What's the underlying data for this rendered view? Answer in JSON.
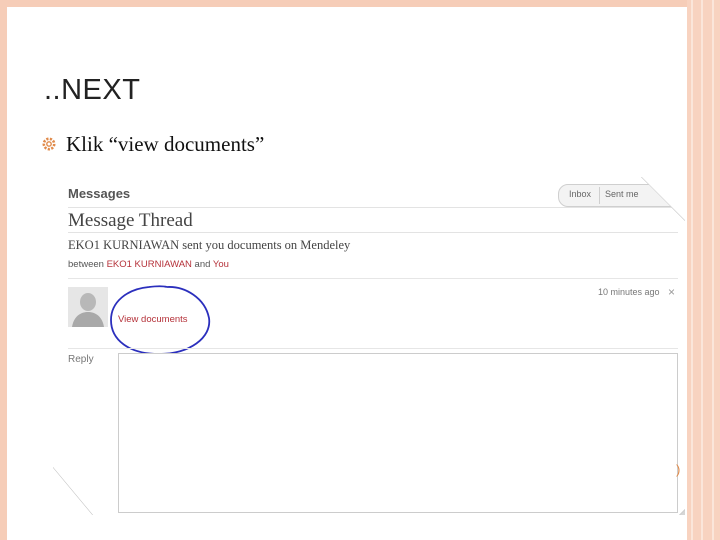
{
  "slide": {
    "title": "..NEXT",
    "bullet": "Klik “view documents”",
    "corner_mark": ")"
  },
  "messages": {
    "header": "Messages",
    "tabs": [
      {
        "label": "Inbox"
      },
      {
        "label": "Sent me"
      }
    ],
    "thread_title": "Message Thread",
    "subject": "EKO1 KURNIAWAN sent you documents on Mendeley",
    "between_prefix": "between",
    "between_name": "EKO1 KURNIAWAN",
    "between_and": "and",
    "between_you": "You",
    "view_documents": "View documents",
    "timestamp": "10 minutes ago",
    "close_symbol": "×",
    "reply_label": "Reply"
  },
  "colors": {
    "frame": "#f6cdb8",
    "link_red": "#b5323a",
    "annotation_blue": "#2b2fbd",
    "bullet_orange": "#e08a4a"
  },
  "icons": {
    "bullet": "gear-bullet-icon",
    "avatar": "user-silhouette-icon"
  }
}
